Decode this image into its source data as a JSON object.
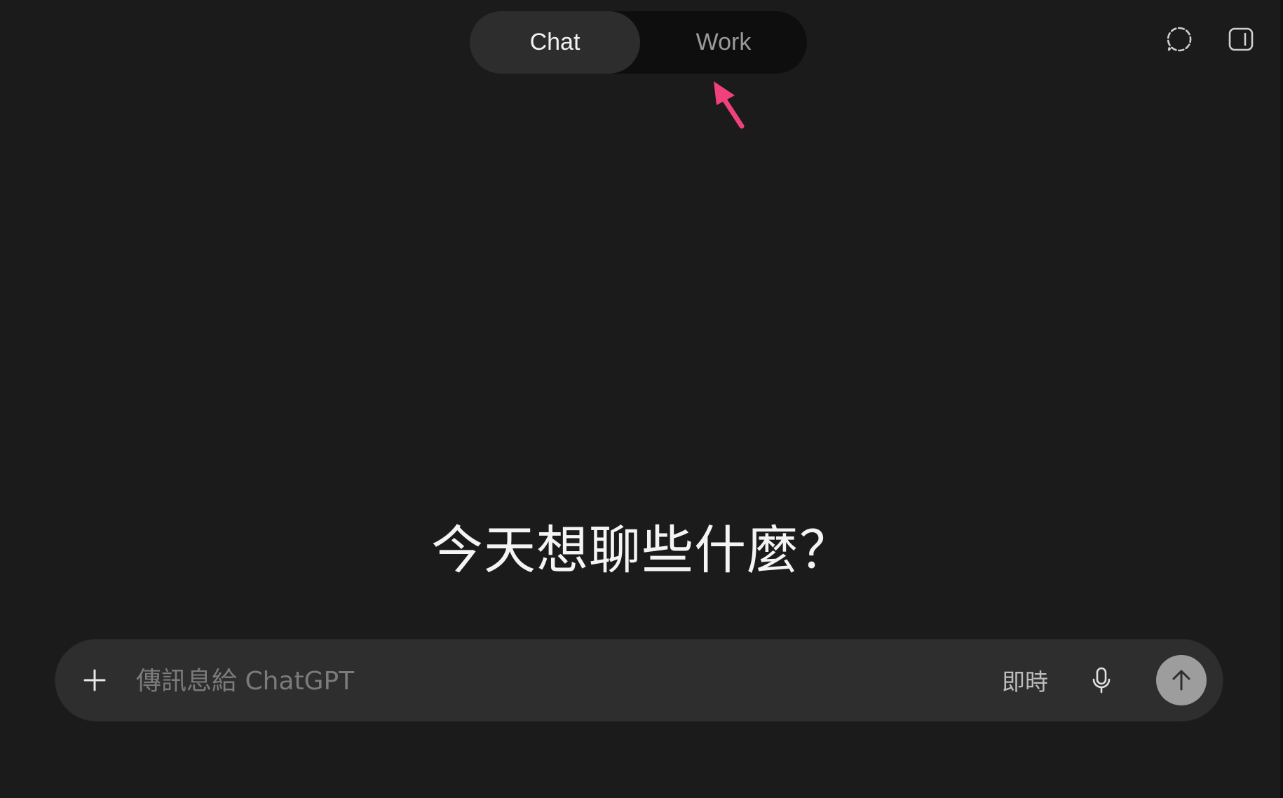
{
  "mode_switch": {
    "tabs": [
      {
        "label": "Chat",
        "active": true
      },
      {
        "label": "Work",
        "active": false
      }
    ]
  },
  "top_right": {
    "icons": [
      "temporary-chat-icon",
      "sidebar-toggle-icon"
    ]
  },
  "annotation": {
    "color": "#f0407d",
    "icon": "pointer-arrow-icon"
  },
  "main": {
    "heading": "今天想聊些什麼？"
  },
  "composer": {
    "placeholder": "傳訊息給 ChatGPT",
    "value": "",
    "realtime_label": "即時",
    "icons": [
      "plus-icon",
      "microphone-icon",
      "arrow-up-icon"
    ]
  },
  "colors": {
    "background": "#1b1b1b",
    "composer": "#2e2e2e",
    "active_tab": "#2d2d2d",
    "send_button": "#9d9d9d"
  }
}
